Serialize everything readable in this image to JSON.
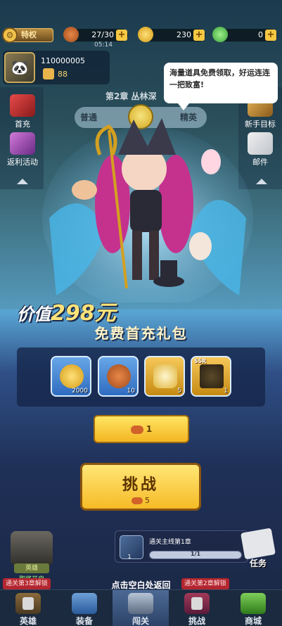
{
  "topbar": {
    "vip_label": "特权",
    "stamina": "27/30",
    "timer": "05:14",
    "coins": "230",
    "gems": "0"
  },
  "profile": {
    "uid": "110000005",
    "power": "88"
  },
  "left_menu": [
    {
      "label": "首充"
    },
    {
      "label": "返利活动"
    }
  ],
  "right_menu": [
    {
      "label": "新手目标"
    },
    {
      "label": "邮件"
    }
  ],
  "chapter": {
    "title": "第2章 丛林深",
    "normal": "普通",
    "elite": "精英"
  },
  "bubble": {
    "text": "海量道具免费领取，好运连连一把致富!"
  },
  "offer": {
    "value_prefix": "价值",
    "value_num": "298元",
    "name": "免费首充礼包",
    "items": [
      {
        "icon": "coin-icon",
        "count": "2000"
      },
      {
        "icon": "meat-icon",
        "count": "10"
      },
      {
        "icon": "helmet-icon",
        "count": "5"
      },
      {
        "icon": "ssr-card-icon",
        "count": "1",
        "badge": "SSR"
      }
    ],
    "buy_count": "1"
  },
  "challenge": {
    "label": "挑战",
    "cost": "5"
  },
  "bottom": {
    "hero_tag": "英雄",
    "hero_soon": "即将开启",
    "quest_title": "通关主线第1章",
    "quest_progress": "1/1",
    "quest_fill": 1.0,
    "task_label": "任务",
    "unlock_left": "通关第3章解锁",
    "unlock_right": "通关第2章解锁",
    "tap_back": "点击空白处返回"
  },
  "nav": [
    {
      "label": "英雄"
    },
    {
      "label": "装备"
    },
    {
      "label": "闯关"
    },
    {
      "label": "挑战"
    },
    {
      "label": "商城"
    }
  ],
  "colors": {
    "accent_gold": "#f6bb27",
    "unlock_red": "#b3262f"
  }
}
